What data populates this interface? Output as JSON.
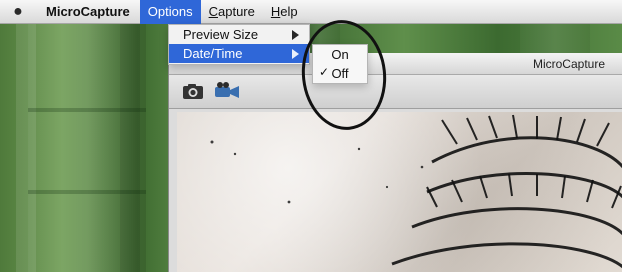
{
  "menubar": {
    "apple_icon": "apple-logo-icon",
    "app_name": "MicroCapture",
    "menus": [
      {
        "label": "Options"
      },
      {
        "label": "Capture"
      },
      {
        "label": "Help"
      }
    ]
  },
  "options_menu": {
    "items": [
      {
        "label": "Preview Size",
        "submenu_icon": "chevron-right-icon"
      },
      {
        "label": "Date/Time",
        "submenu_icon": "chevron-right-icon"
      }
    ]
  },
  "datetime_submenu": {
    "items": [
      {
        "label": "On",
        "checked": false
      },
      {
        "label": "Off",
        "checked": true
      }
    ],
    "check_icon": "checkmark-icon"
  },
  "window": {
    "title": "MicroCapture",
    "toolbar": {
      "buttons": [
        {
          "icon": "camera-icon"
        },
        {
          "icon": "video-camera-icon"
        }
      ]
    }
  },
  "colors": {
    "menu_highlight": "#2f67d8",
    "menu_bg": "#f2f2f2",
    "annotation": "#111111"
  }
}
